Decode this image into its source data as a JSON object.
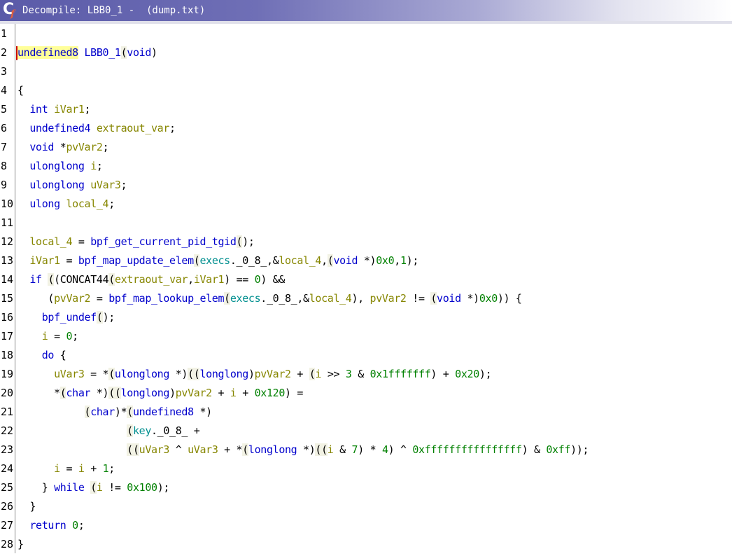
{
  "window": {
    "title": "Decompile: LBB0_1 -  (dump.txt)",
    "logo": {
      "icon": "ghidra-decompiler-icon",
      "letter": "C",
      "sub": "f"
    }
  },
  "colors": {
    "keyword": "#0000cc",
    "function": "#0000cc",
    "variable": "#868600",
    "number": "#008000",
    "global": "#008f8f",
    "highlight": "#ffff99"
  },
  "lines": [
    {
      "n": "1",
      "tokens": []
    },
    {
      "n": "2",
      "tokens": [
        [
          "undefined8",
          "kw hl"
        ],
        [
          " ",
          ""
        ],
        [
          "LBB0_1",
          "fn"
        ],
        [
          "(",
          "paren"
        ],
        [
          "void",
          "kw"
        ],
        [
          ")",
          ""
        ]
      ]
    },
    {
      "n": "3",
      "tokens": []
    },
    {
      "n": "4",
      "tokens": [
        [
          "{",
          ""
        ]
      ]
    },
    {
      "n": "5",
      "tokens": [
        [
          "  ",
          ""
        ],
        [
          "int",
          "kw"
        ],
        [
          " ",
          ""
        ],
        [
          "iVar1",
          "var"
        ],
        [
          ";",
          ""
        ]
      ]
    },
    {
      "n": "6",
      "tokens": [
        [
          "  ",
          ""
        ],
        [
          "undefined4",
          "kw"
        ],
        [
          " ",
          ""
        ],
        [
          "extraout_var",
          "var"
        ],
        [
          ";",
          ""
        ]
      ]
    },
    {
      "n": "7",
      "tokens": [
        [
          "  ",
          ""
        ],
        [
          "void",
          "kw"
        ],
        [
          " *",
          ""
        ],
        [
          "pvVar2",
          "var"
        ],
        [
          ";",
          ""
        ]
      ]
    },
    {
      "n": "8",
      "tokens": [
        [
          "  ",
          ""
        ],
        [
          "ulonglong",
          "kw"
        ],
        [
          " ",
          ""
        ],
        [
          "i",
          "var"
        ],
        [
          ";",
          ""
        ]
      ]
    },
    {
      "n": "9",
      "tokens": [
        [
          "  ",
          ""
        ],
        [
          "ulonglong",
          "kw"
        ],
        [
          " ",
          ""
        ],
        [
          "uVar3",
          "var"
        ],
        [
          ";",
          ""
        ]
      ]
    },
    {
      "n": "10",
      "tokens": [
        [
          "  ",
          ""
        ],
        [
          "ulong",
          "kw"
        ],
        [
          " ",
          ""
        ],
        [
          "local_4",
          "var"
        ],
        [
          ";",
          ""
        ]
      ]
    },
    {
      "n": "11",
      "tokens": []
    },
    {
      "n": "12",
      "tokens": [
        [
          "  ",
          ""
        ],
        [
          "local_4",
          "var"
        ],
        [
          " = ",
          ""
        ],
        [
          "bpf_get_current_pid_tgid",
          "fn"
        ],
        [
          "(",
          "paren"
        ],
        [
          ");",
          ""
        ]
      ]
    },
    {
      "n": "13",
      "tokens": [
        [
          "  ",
          ""
        ],
        [
          "iVar1",
          "var"
        ],
        [
          " = ",
          ""
        ],
        [
          "bpf_map_update_elem",
          "fn"
        ],
        [
          "(",
          "paren"
        ],
        [
          "execs",
          "glob"
        ],
        [
          "._0_8_,&",
          ""
        ],
        [
          "local_4",
          "var"
        ],
        [
          ",",
          ""
        ],
        [
          "(",
          "paren"
        ],
        [
          "void",
          "kw"
        ],
        [
          " *)",
          ""
        ],
        [
          "0x0",
          "num"
        ],
        [
          ",",
          ""
        ],
        [
          "1",
          "num"
        ],
        [
          ");",
          ""
        ]
      ]
    },
    {
      "n": "14",
      "tokens": [
        [
          "  ",
          ""
        ],
        [
          "if",
          "kw"
        ],
        [
          " ",
          ""
        ],
        [
          "(",
          "paren"
        ],
        [
          "(CONCAT44",
          ""
        ],
        [
          "(",
          "paren"
        ],
        [
          "extraout_var",
          "var"
        ],
        [
          ",",
          ""
        ],
        [
          "iVar1",
          "var"
        ],
        [
          ") == ",
          ""
        ],
        [
          "0",
          "num"
        ],
        [
          ") &&",
          ""
        ]
      ]
    },
    {
      "n": "15",
      "tokens": [
        [
          "     (",
          ""
        ],
        [
          "pvVar2",
          "var"
        ],
        [
          " = ",
          ""
        ],
        [
          "bpf_map_lookup_elem",
          "fn"
        ],
        [
          "(",
          "paren"
        ],
        [
          "execs",
          "glob"
        ],
        [
          "._0_8_,&",
          ""
        ],
        [
          "local_4",
          "var"
        ],
        [
          "), ",
          ""
        ],
        [
          "pvVar2",
          "var"
        ],
        [
          " != ",
          ""
        ],
        [
          "(",
          "paren"
        ],
        [
          "void",
          "kw"
        ],
        [
          " *)",
          ""
        ],
        [
          "0x0",
          "num"
        ],
        [
          ")) {",
          ""
        ]
      ]
    },
    {
      "n": "16",
      "tokens": [
        [
          "    ",
          ""
        ],
        [
          "bpf_undef",
          "fn"
        ],
        [
          "(",
          "paren"
        ],
        [
          ");",
          ""
        ]
      ]
    },
    {
      "n": "17",
      "tokens": [
        [
          "    ",
          ""
        ],
        [
          "i",
          "var"
        ],
        [
          " = ",
          ""
        ],
        [
          "0",
          "num"
        ],
        [
          ";",
          ""
        ]
      ]
    },
    {
      "n": "18",
      "tokens": [
        [
          "    ",
          ""
        ],
        [
          "do",
          "kw"
        ],
        [
          " {",
          ""
        ]
      ]
    },
    {
      "n": "19",
      "tokens": [
        [
          "      ",
          ""
        ],
        [
          "uVar3",
          "var"
        ],
        [
          " = *",
          ""
        ],
        [
          "(",
          "paren"
        ],
        [
          "ulonglong",
          "kw"
        ],
        [
          " *)",
          ""
        ],
        [
          "(",
          "paren"
        ],
        [
          "(",
          "paren"
        ],
        [
          "longlong",
          "kw"
        ],
        [
          ")",
          ""
        ],
        [
          "pvVar2",
          "var"
        ],
        [
          " + ",
          ""
        ],
        [
          "(",
          "paren"
        ],
        [
          "i",
          "var"
        ],
        [
          " >> ",
          ""
        ],
        [
          "3",
          "num"
        ],
        [
          " & ",
          ""
        ],
        [
          "0x1fffffff",
          "num"
        ],
        [
          ") + ",
          ""
        ],
        [
          "0x20",
          "num"
        ],
        [
          ");",
          ""
        ]
      ]
    },
    {
      "n": "20",
      "tokens": [
        [
          "      *",
          ""
        ],
        [
          "(",
          "paren"
        ],
        [
          "char",
          "kw"
        ],
        [
          " *)",
          ""
        ],
        [
          "(",
          "paren"
        ],
        [
          "(",
          "paren"
        ],
        [
          "longlong",
          "kw"
        ],
        [
          ")",
          ""
        ],
        [
          "pvVar2",
          "var"
        ],
        [
          " + ",
          ""
        ],
        [
          "i",
          "var"
        ],
        [
          " + ",
          ""
        ],
        [
          "0x120",
          "num"
        ],
        [
          ") =",
          ""
        ]
      ]
    },
    {
      "n": "21",
      "tokens": [
        [
          "           ",
          ""
        ],
        [
          "(",
          "paren"
        ],
        [
          "char",
          "kw"
        ],
        [
          ")*",
          ""
        ],
        [
          "(",
          "paren"
        ],
        [
          "undefined8",
          "kw"
        ],
        [
          " *)",
          ""
        ]
      ]
    },
    {
      "n": "22",
      "tokens": [
        [
          "                  ",
          ""
        ],
        [
          "(",
          "paren"
        ],
        [
          "key",
          "glob"
        ],
        [
          "._0_8_ +",
          ""
        ]
      ]
    },
    {
      "n": "23",
      "tokens": [
        [
          "                  ",
          ""
        ],
        [
          "(",
          "paren"
        ],
        [
          "(",
          "paren"
        ],
        [
          "uVar3",
          "var"
        ],
        [
          " ^ ",
          ""
        ],
        [
          "uVar3",
          "var"
        ],
        [
          " + *",
          ""
        ],
        [
          "(",
          "paren"
        ],
        [
          "longlong",
          "kw"
        ],
        [
          " *)",
          ""
        ],
        [
          "(",
          "paren"
        ],
        [
          "(",
          "paren"
        ],
        [
          "i",
          "var"
        ],
        [
          " & ",
          ""
        ],
        [
          "7",
          "num"
        ],
        [
          ") * ",
          ""
        ],
        [
          "4",
          "num"
        ],
        [
          ") ^ ",
          ""
        ],
        [
          "0xffffffffffffffff",
          "num"
        ],
        [
          ") & ",
          ""
        ],
        [
          "0xff",
          "num"
        ],
        [
          "));",
          ""
        ]
      ]
    },
    {
      "n": "24",
      "tokens": [
        [
          "      ",
          ""
        ],
        [
          "i",
          "var"
        ],
        [
          " = ",
          ""
        ],
        [
          "i",
          "var"
        ],
        [
          " + ",
          ""
        ],
        [
          "1",
          "num"
        ],
        [
          ";",
          ""
        ]
      ]
    },
    {
      "n": "25",
      "tokens": [
        [
          "    } ",
          ""
        ],
        [
          "while",
          "kw"
        ],
        [
          " ",
          ""
        ],
        [
          "(",
          "paren"
        ],
        [
          "i",
          "var"
        ],
        [
          " != ",
          ""
        ],
        [
          "0x100",
          "num"
        ],
        [
          ");",
          ""
        ]
      ]
    },
    {
      "n": "26",
      "tokens": [
        [
          "  }",
          ""
        ]
      ]
    },
    {
      "n": "27",
      "tokens": [
        [
          "  ",
          ""
        ],
        [
          "return",
          "kw"
        ],
        [
          " ",
          ""
        ],
        [
          "0",
          "num"
        ],
        [
          ";",
          ""
        ]
      ]
    },
    {
      "n": "28",
      "tokens": [
        [
          "}",
          ""
        ]
      ]
    }
  ]
}
